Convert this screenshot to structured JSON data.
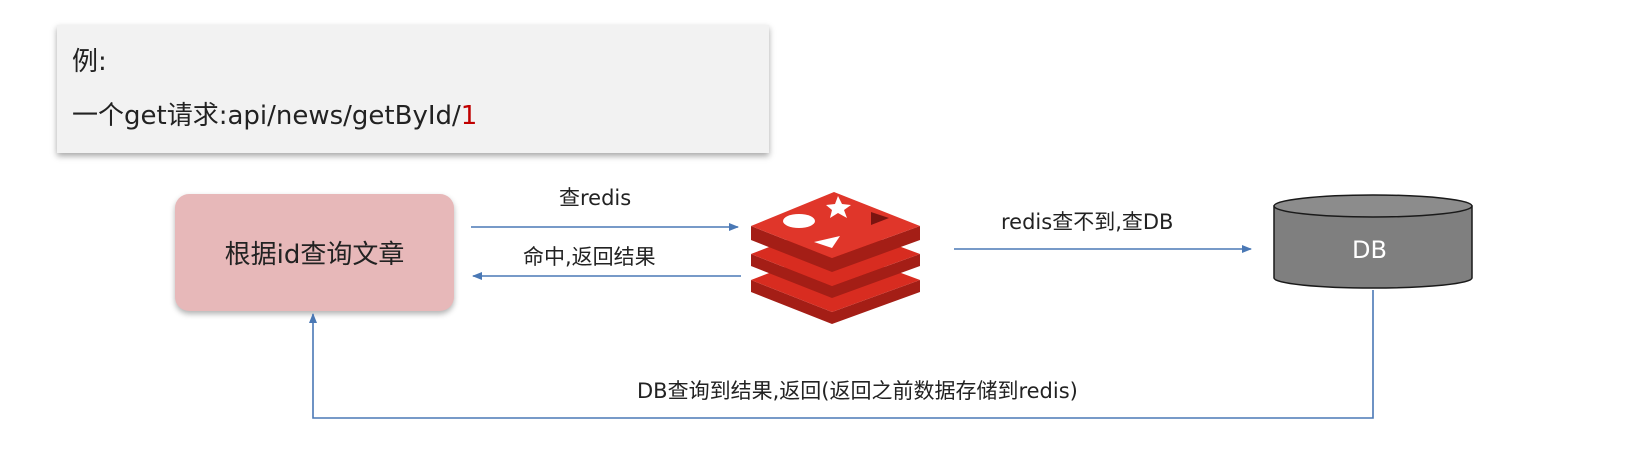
{
  "example": {
    "label": "例:",
    "request_prefix": "一个get请求:api/news/getById/",
    "request_id": "1"
  },
  "nodes": {
    "query_article": "根据id查询文章",
    "db": "DB"
  },
  "edges": {
    "query_redis": "查redis",
    "hit_return": "命中,返回结果",
    "redis_miss_query_db": "redis查不到,查DB",
    "db_return": "DB查询到结果,返回(返回之前数据存储到redis)"
  },
  "colors": {
    "arrow": "#4a78b5",
    "query_box": "#e7b8b9",
    "redis_red": "#d82c20",
    "db_gray": "#7f7f7f",
    "request_id": "#c00000"
  }
}
